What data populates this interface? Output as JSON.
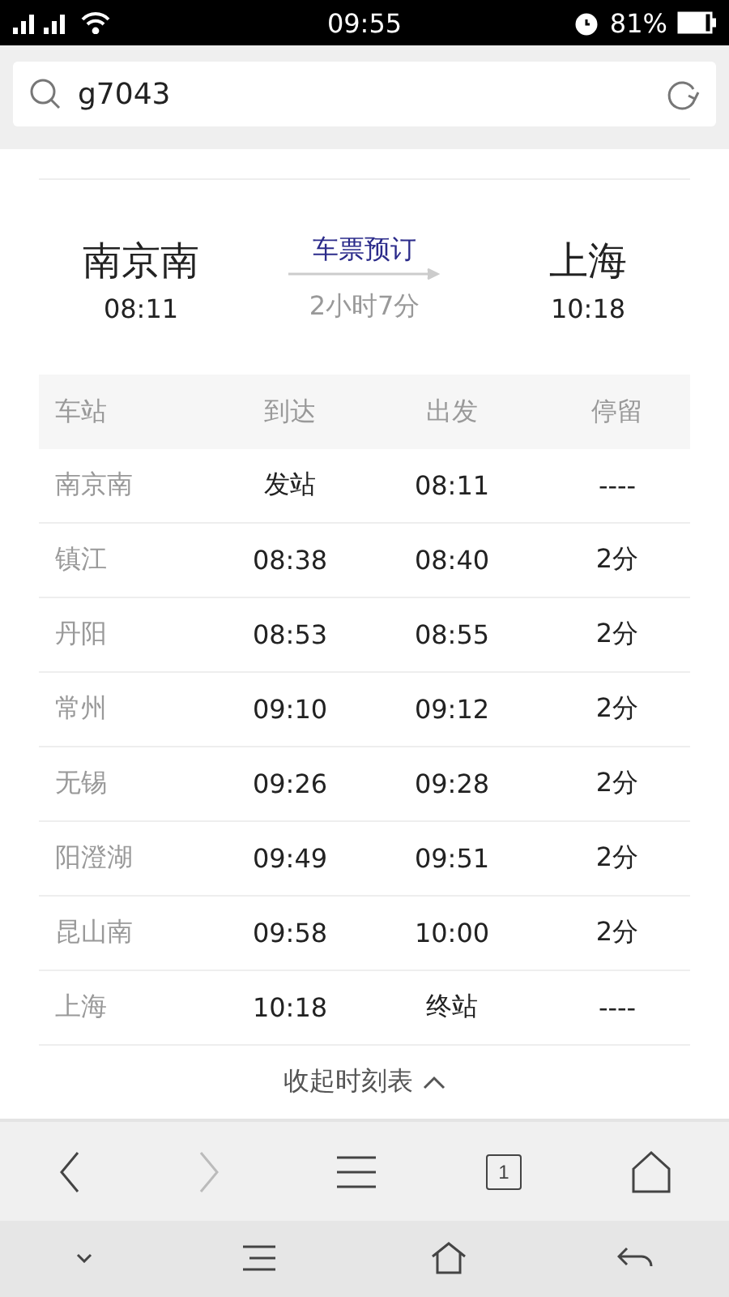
{
  "status_bar": {
    "time": "09:55",
    "battery_text": "81%"
  },
  "search": {
    "value": "g7043"
  },
  "route": {
    "from": {
      "station": "南京南",
      "time": "08:11"
    },
    "booking_link": "车票预订",
    "duration": "2小时7分",
    "to": {
      "station": "上海",
      "time": "10:18"
    }
  },
  "table": {
    "columns": [
      "车站",
      "到达",
      "出发",
      "停留"
    ],
    "rows": [
      {
        "station": "南京南",
        "arrive": "发站",
        "depart": "08:11",
        "stop": "----"
      },
      {
        "station": "镇江",
        "arrive": "08:38",
        "depart": "08:40",
        "stop": "2分"
      },
      {
        "station": "丹阳",
        "arrive": "08:53",
        "depart": "08:55",
        "stop": "2分"
      },
      {
        "station": "常州",
        "arrive": "09:10",
        "depart": "09:12",
        "stop": "2分"
      },
      {
        "station": "无锡",
        "arrive": "09:26",
        "depart": "09:28",
        "stop": "2分"
      },
      {
        "station": "阳澄湖",
        "arrive": "09:49",
        "depart": "09:51",
        "stop": "2分"
      },
      {
        "station": "昆山南",
        "arrive": "09:58",
        "depart": "10:00",
        "stop": "2分"
      },
      {
        "station": "上海",
        "arrive": "10:18",
        "depart": "终站",
        "stop": "----"
      }
    ]
  },
  "collapse_link": "收起时刻表",
  "browser_nav": {
    "back_disabled": false,
    "forward_disabled": true,
    "tab_count": "1"
  }
}
